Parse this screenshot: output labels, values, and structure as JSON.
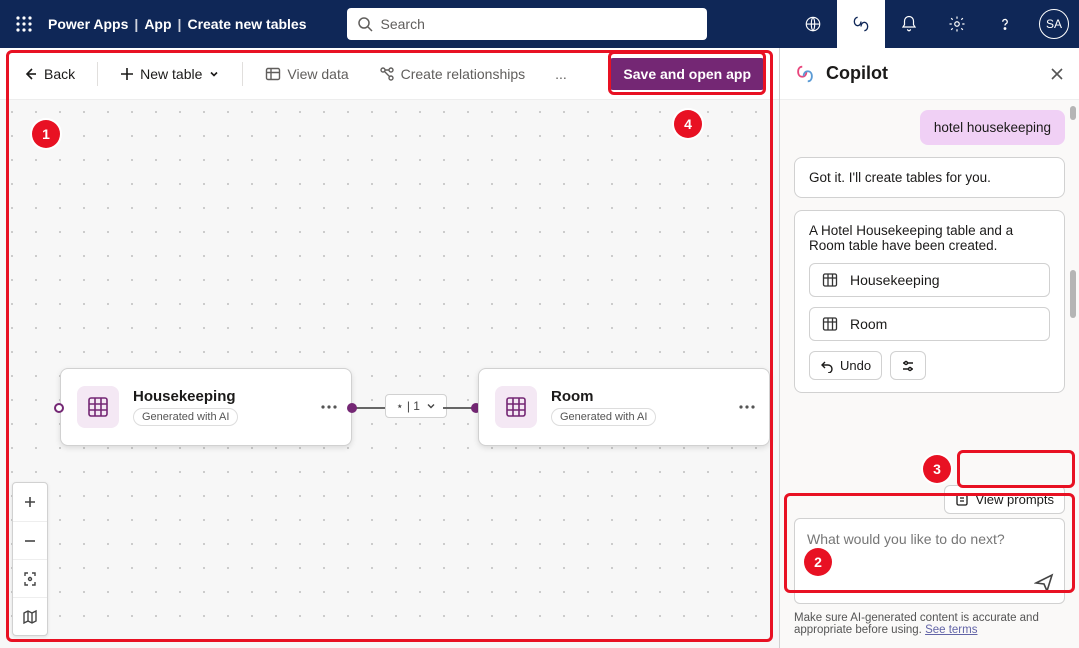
{
  "header": {
    "app_name": "Power Apps",
    "crumb_app": "App",
    "crumb_page": "Create new tables",
    "search_placeholder": "Search",
    "avatar_initials": "SA"
  },
  "toolbar": {
    "back": "Back",
    "new_table": "New table",
    "view_data": "View data",
    "create_relationships": "Create relationships",
    "more": "...",
    "save": "Save and open app"
  },
  "tables": [
    {
      "name": "Housekeeping",
      "tag": "Generated with AI"
    },
    {
      "name": "Room",
      "tag": "Generated with AI"
    }
  ],
  "relationship": {
    "label": "⋆ | 1"
  },
  "copilot": {
    "title": "Copilot",
    "user_msg": "hotel housekeeping",
    "assistant_msg": "Got it. I'll create tables for you.",
    "created_msg": "A Hotel Housekeeping table and a Room table have been created.",
    "table_buttons": [
      "Housekeeping",
      "Room"
    ],
    "undo": "Undo",
    "view_prompts": "View prompts",
    "input_placeholder": "What would you like to do next?",
    "footer": "Make sure AI-generated content is accurate and appropriate before using. ",
    "footer_link": "See terms"
  },
  "callouts": [
    "1",
    "2",
    "3",
    "4"
  ]
}
